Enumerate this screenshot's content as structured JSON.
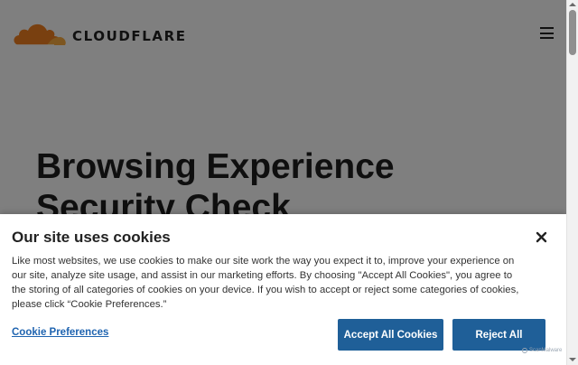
{
  "header": {
    "logo_text": "CLOUDFLARE",
    "logo_icon": "cloud-logo-icon",
    "menu_icon": "hamburger-menu-icon"
  },
  "hero": {
    "title": "Browsing Experience Security Check"
  },
  "cookie_banner": {
    "title": "Our site uses cookies",
    "description": "Like most websites, we use cookies to make our site work the way you expect it to, improve your experience on our site, analyze site usage, and assist in our marketing efforts. By choosing \"Accept All Cookies\", you agree to the storing of all categories of cookies on your device. If you wish to accept or reject some categories of cookies, please click “Cookie Preferences.”",
    "preferences_link": "Cookie Preferences",
    "accept_button": "Accept All Cookies",
    "reject_button": "Reject All",
    "close_icon": "close-icon",
    "powered_by": "ScanMalware"
  },
  "colors": {
    "brand_orange": "#f38020",
    "brand_orange_light": "#fbad41",
    "button_blue": "#1f5f98",
    "link_blue": "#1f64b0",
    "overlay": "rgba(0,0,0,0.5)"
  }
}
